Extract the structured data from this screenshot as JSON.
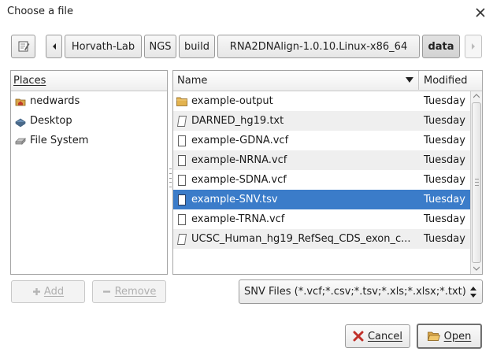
{
  "dialog": {
    "title": "Choose a file"
  },
  "pathbar": {
    "segments": [
      "Horvath-Lab",
      "NGS",
      "build",
      "RNA2DNAlign-1.0.10.Linux-x86_64",
      "data"
    ]
  },
  "places": {
    "header": "Places",
    "items": [
      {
        "label": "nedwards",
        "icon": "home-folder-icon"
      },
      {
        "label": "Desktop",
        "icon": "desktop-icon"
      },
      {
        "label": "File System",
        "icon": "drive-icon"
      }
    ]
  },
  "files": {
    "header_name": "Name",
    "header_modified": "Modified",
    "rows": [
      {
        "name": "example-output",
        "modified": "Tuesday",
        "icon": "folder-icon"
      },
      {
        "name": "DARNED_hg19.txt",
        "modified": "Tuesday",
        "icon": "text-file-icon"
      },
      {
        "name": "example-GDNA.vcf",
        "modified": "Tuesday",
        "icon": "file-icon"
      },
      {
        "name": "example-NRNA.vcf",
        "modified": "Tuesday",
        "icon": "file-icon"
      },
      {
        "name": "example-SDNA.vcf",
        "modified": "Tuesday",
        "icon": "file-icon"
      },
      {
        "name": "example-SNV.tsv",
        "modified": "Tuesday",
        "icon": "file-icon",
        "selected": true
      },
      {
        "name": "example-TRNA.vcf",
        "modified": "Tuesday",
        "icon": "file-icon"
      },
      {
        "name": "UCSC_Human_hg19_RefSeq_CDS_exon_c...",
        "modified": "Tuesday",
        "icon": "text-file-icon"
      }
    ]
  },
  "actions": {
    "add": "Add",
    "remove": "Remove"
  },
  "filter": {
    "selected": "SNV Files (*.vcf;*.csv;*.tsv;*.xls;*.xlsx;*.txt)"
  },
  "buttons": {
    "cancel": "Cancel",
    "open": "Open"
  },
  "colors": {
    "selection": "#3b7cc9",
    "cancel_icon": "#c0302a"
  }
}
